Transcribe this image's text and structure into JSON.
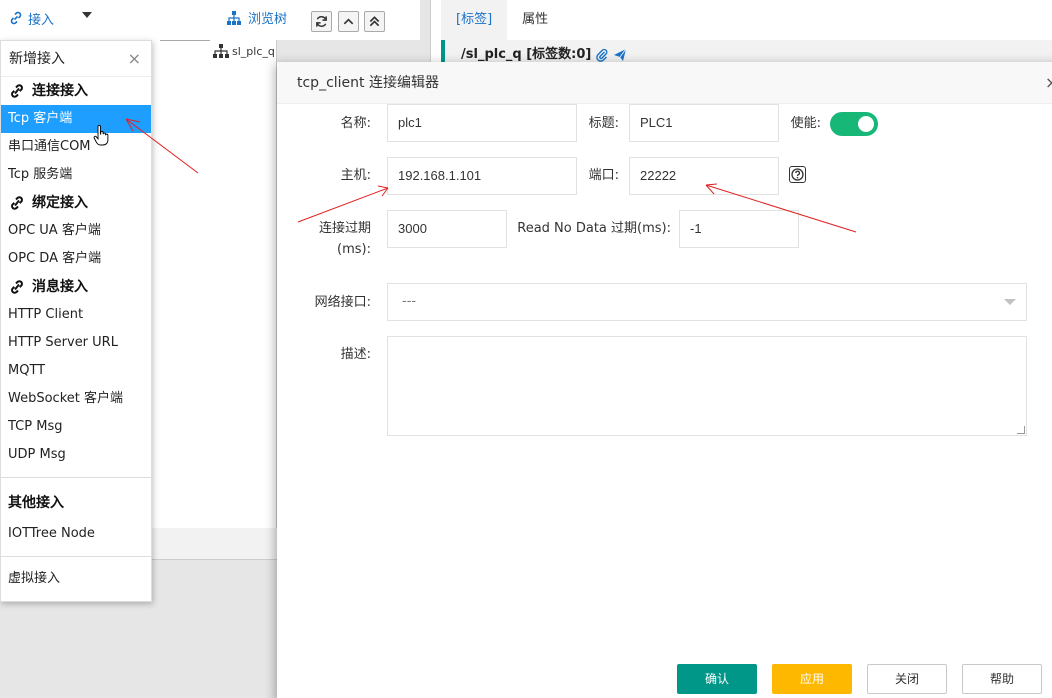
{
  "toolbar": {
    "connect_label": "接入",
    "browse_label": "浏览树"
  },
  "tree": {
    "node_label": "sl_plc_q"
  },
  "right_panel": {
    "tabs": [
      {
        "label": "[标签]"
      },
      {
        "label": "属性"
      }
    ],
    "path_text": "/sl_plc_q [标签数:0]"
  },
  "menu": {
    "title": "新增接入",
    "close": "×",
    "sections": [
      {
        "title": "连接接入",
        "items": [
          "Tcp 客户端",
          "串口通信COM",
          "Tcp 服务端"
        ]
      },
      {
        "title": "绑定接入",
        "items": [
          "OPC UA 客户端",
          "OPC DA 客户端"
        ]
      },
      {
        "title": "消息接入",
        "items": [
          "HTTP Client",
          "HTTP Server URL",
          "MQTT",
          "WebSocket 客户端",
          "TCP Msg",
          "UDP Msg"
        ]
      }
    ],
    "other_title": "其他接入",
    "other_items": [
      "IOTTree Node"
    ],
    "virtual_label": "虚拟接入",
    "selected": "Tcp 客户端"
  },
  "dialog": {
    "title": "tcp_client 连接编辑器",
    "close": "×",
    "name_label": "名称:",
    "name_value": "plc1",
    "title_label": "标题:",
    "title_value": "PLC1",
    "enable_label": "使能:",
    "enabled": true,
    "host_label": "主机:",
    "host_value": "192.168.1.101",
    "port_label": "端口:",
    "port_value": "22222",
    "timeout_label_1": "连接过期",
    "timeout_label_2": "(ms):",
    "timeout_value": "3000",
    "readnodata_label": "Read No Data 过期(ms):",
    "readnodata_value": "-1",
    "netif_label": "网络接口:",
    "netif_value": "---",
    "desc_label": "描述:",
    "desc_value": "",
    "buttons": {
      "ok": "确认",
      "apply": "应用",
      "close": "关闭",
      "help": "帮助"
    }
  },
  "colors": {
    "accent_blue": "#1e9fff",
    "teal": "#009688",
    "toggle_green": "#16b777",
    "apply_yellow": "#ffb800",
    "annotation_red": "#e02020"
  }
}
